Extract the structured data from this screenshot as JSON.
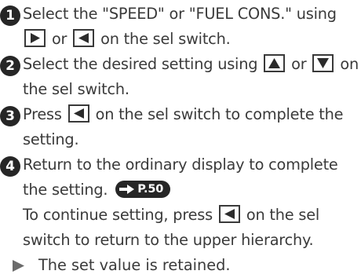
{
  "steps": [
    {
      "number": "1",
      "line1_text": "Select the \"SPEED\" or \"FUEL CONS.\" using",
      "line2_or": "or",
      "line2_tail": "on the sel switch.",
      "icons": [
        "right-triangle-icon",
        "left-triangle-icon"
      ]
    },
    {
      "number": "2",
      "line1_text": "Select the desired setting using",
      "line1_or": "or",
      "line1_tail": "on",
      "line2_text": "the sel switch.",
      "icons": [
        "up-triangle-icon",
        "down-triangle-icon"
      ]
    },
    {
      "number": "3",
      "line1_pre": "Press",
      "line1_tail": "on the sel switch to complete the",
      "line2_text": "setting.",
      "icons": [
        "left-triangle-icon"
      ]
    },
    {
      "number": "4",
      "line1_text": "Return to the ordinary display to complete",
      "line2_text": "the setting.",
      "ref_label": "P.50",
      "cont_line1_pre": "To continue setting, press",
      "cont_line1_tail": "on the sel",
      "cont_line2_text": "switch to return to the upper hierarchy.",
      "note_text": "The set value is retained.",
      "icons": [
        "arrow-right-icon",
        "left-triangle-icon",
        "note-triangle-icon"
      ]
    }
  ],
  "colors": {
    "text": "#3a3a3a",
    "badge": "#262626",
    "icon_fill": "#2b2b2b",
    "note_triangle": "#6b6b6b"
  }
}
